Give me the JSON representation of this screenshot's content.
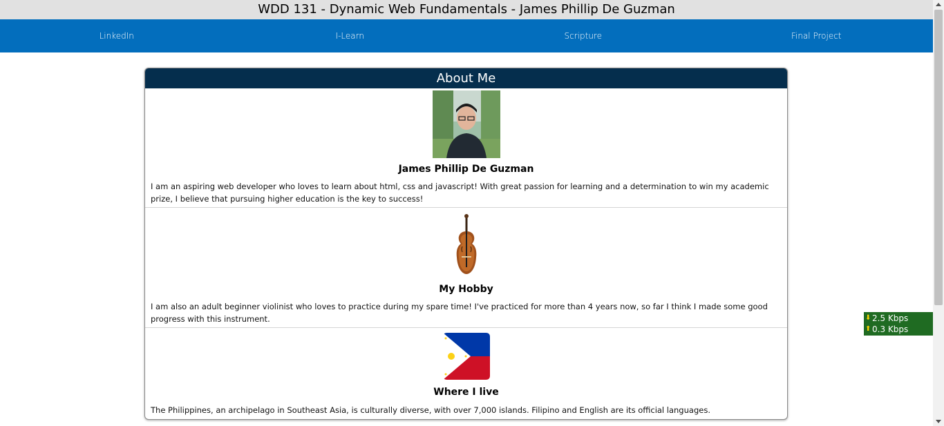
{
  "header": {
    "title": "WDD 131 - Dynamic Web Fundamentals - James Phillip De Guzman"
  },
  "nav": {
    "items": [
      {
        "label": "LinkedIn"
      },
      {
        "label": "I-Learn"
      },
      {
        "label": "Scripture"
      },
      {
        "label": "Final Project"
      }
    ]
  },
  "card": {
    "title": "About Me",
    "sections": [
      {
        "image": "profile-photo",
        "heading": "James Phillip De Guzman",
        "text": "I am an aspiring web developer who loves to learn about html, css and javascript! With great passion for learning and a determination to win my academic prize, I believe that pursuing higher education is the key to success!"
      },
      {
        "image": "violin",
        "heading": "My Hobby",
        "text": "I am also an adult beginner violinist who loves to practice during my spare time! I've practiced for more than 4 years now, so far I think I made some good progress with this instrument."
      },
      {
        "image": "philippine-flag",
        "heading": "Where I live",
        "text": "The Philippines, an archipelago in Southeast Asia, is culturally diverse, with over 7,000 islands. Filipino and English are its official languages."
      }
    ]
  },
  "network_monitor": {
    "download": "2.5 Kbps",
    "upload": "0.3 Kbps"
  },
  "colors": {
    "nav_bg": "#036ebd",
    "card_title_bg": "#052e4d",
    "header_bg": "#e1e1e1",
    "net_bg": "#1f6b22"
  }
}
